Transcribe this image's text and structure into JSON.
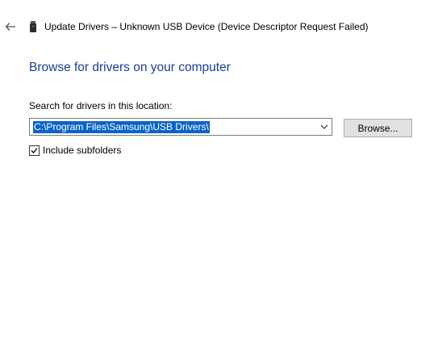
{
  "header": {
    "back_icon": "arrow-left-icon",
    "device_icon": "usb-device-icon",
    "title": "Update Drivers – Unknown USB Device (Device Descriptor Request Failed)"
  },
  "main": {
    "page_title": "Browse for drivers on your computer",
    "location_label": "Search for drivers in this location:",
    "location_value": "C:\\Program Files\\Samsung\\USB Drivers\\",
    "browse_label": "Browse...",
    "include_subfolders_label": "Include subfolders",
    "include_subfolders_checked": true
  },
  "colors": {
    "title_blue": "#1a3e9a",
    "selection_blue": "#0a64c8"
  }
}
